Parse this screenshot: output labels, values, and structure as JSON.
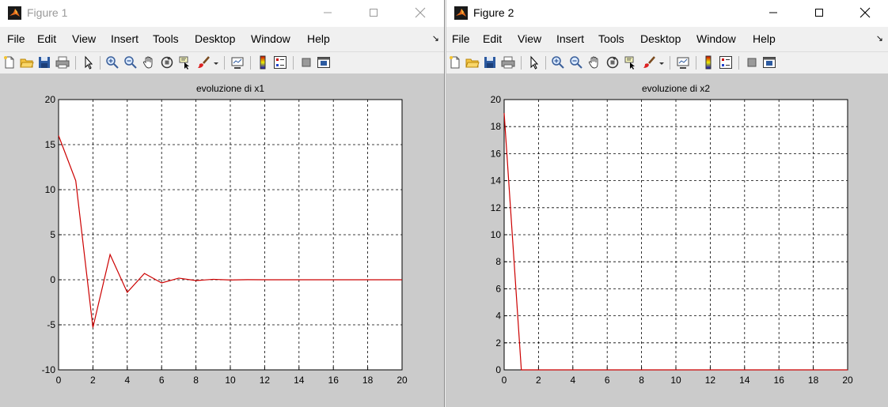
{
  "figure1": {
    "title": "Figure 1",
    "menu": [
      "File",
      "Edit",
      "View",
      "Insert",
      "Tools",
      "Desktop",
      "Window",
      "Help"
    ],
    "menu_more": "↘"
  },
  "figure2": {
    "title": "Figure 2",
    "menu": [
      "File",
      "Edit",
      "View",
      "Insert",
      "Tools",
      "Desktop",
      "Window",
      "Help"
    ],
    "menu_more": "↘"
  },
  "toolbar_icons": [
    "new-figure-icon",
    "open-file-icon",
    "save-icon",
    "print-icon",
    "edit-plot-arrow-icon",
    "zoom-in-icon",
    "zoom-out-icon",
    "pan-hand-icon",
    "rotate-3d-icon",
    "data-cursor-icon",
    "brush-icon",
    "brush-dropdown-icon",
    "link-plot-icon",
    "colorbar-icon",
    "legend-icon",
    "hide-plot-tools-icon",
    "show-plot-tools-icon"
  ],
  "colors": {
    "line": "#cc0000",
    "figure_bg": "#cbcbcb",
    "axes_bg": "#ffffff"
  },
  "chart_data": [
    {
      "type": "line",
      "title": "evoluzione di x1",
      "xlabel": "",
      "ylabel": "",
      "xlim": [
        0,
        20
      ],
      "ylim": [
        -10,
        20
      ],
      "xticks": [
        0,
        2,
        4,
        6,
        8,
        10,
        12,
        14,
        16,
        18,
        20
      ],
      "yticks": [
        -10,
        -5,
        0,
        5,
        10,
        15,
        20
      ],
      "grid": true,
      "grid_style": "dashed",
      "series": [
        {
          "x": [
            0,
            1,
            2,
            3,
            4,
            5,
            6,
            7,
            8,
            9,
            10,
            11,
            12,
            13,
            14,
            15,
            16,
            17,
            18,
            19,
            20
          ],
          "y": [
            16,
            11,
            -5.3,
            2.8,
            -1.4,
            0.7,
            -0.35,
            0.18,
            -0.09,
            0.05,
            -0.02,
            0.01,
            0,
            0,
            0,
            0,
            0,
            0,
            0,
            0,
            0
          ],
          "color": "#cc0000"
        }
      ]
    },
    {
      "type": "line",
      "title": "evoluzione di x2",
      "xlabel": "",
      "ylabel": "",
      "xlim": [
        0,
        20
      ],
      "ylim": [
        0,
        20
      ],
      "xticks": [
        0,
        2,
        4,
        6,
        8,
        10,
        12,
        14,
        16,
        18,
        20
      ],
      "yticks": [
        0,
        2,
        4,
        6,
        8,
        10,
        12,
        14,
        16,
        18,
        20
      ],
      "grid": true,
      "grid_style": "dashed",
      "series": [
        {
          "x": [
            0,
            1,
            2,
            3,
            4,
            5,
            6,
            7,
            8,
            9,
            10,
            11,
            12,
            13,
            14,
            15,
            16,
            17,
            18,
            19,
            20
          ],
          "y": [
            19,
            0,
            0,
            0,
            0,
            0,
            0,
            0,
            0,
            0,
            0,
            0,
            0,
            0,
            0,
            0,
            0,
            0,
            0,
            0,
            0
          ],
          "color": "#cc0000"
        }
      ]
    }
  ]
}
